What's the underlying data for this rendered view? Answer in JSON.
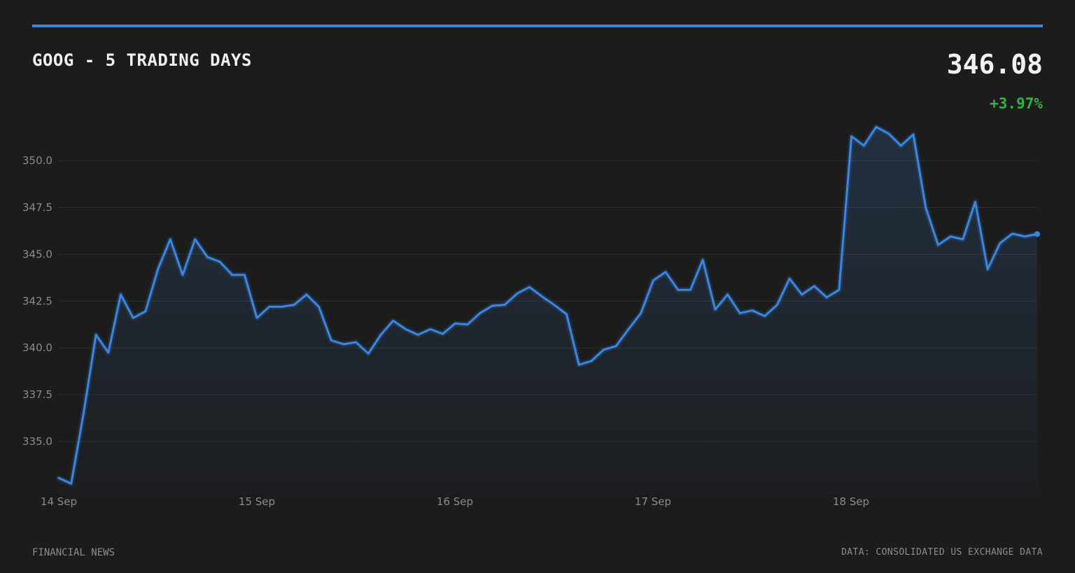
{
  "header": {
    "title": "GOOG - 5 TRADING DAYS",
    "price": "346.08",
    "change": "+3.97%"
  },
  "footer": {
    "source_left": "FINANCIAL NEWS",
    "source_right": "DATA: CONSOLIDATED US EXCHANGE DATA"
  },
  "colors": {
    "background": "#1c1c1c",
    "accent": "#3a86e0",
    "positive": "#2fb344",
    "gridline": "#2e2e2e",
    "tick_text": "#8c8c8c"
  },
  "chart_data": {
    "type": "area",
    "title": "GOOG - 5 TRADING DAYS",
    "xlabel": "",
    "ylabel": "",
    "ylim": [
      332.2,
      352.6
    ],
    "yticks": [
      335.0,
      337.5,
      340.0,
      342.5,
      345.0,
      347.5,
      350.0
    ],
    "ytick_labels": [
      "335.0",
      "337.5",
      "340.0",
      "342.5",
      "345.0",
      "347.5",
      "350.0"
    ],
    "xticks": [
      0,
      1,
      2,
      3,
      4
    ],
    "xtick_labels": [
      "14 Sep",
      "15 Sep",
      "16 Sep",
      "17 Sep",
      "18 Sep"
    ],
    "grid": true,
    "legend": "none",
    "series": [
      {
        "values": [
          333.05,
          332.75,
          336.5,
          340.7,
          339.75,
          342.85,
          341.6,
          341.95,
          344.2,
          345.8,
          343.9,
          345.8,
          344.85,
          344.6,
          343.9,
          343.9,
          341.6,
          342.2,
          342.2,
          342.3,
          342.85,
          342.2,
          340.4,
          340.2,
          340.3,
          339.7,
          340.7,
          341.45,
          341.0,
          340.7,
          341.0,
          340.75,
          341.3,
          341.25,
          341.85,
          342.25,
          342.3,
          342.9,
          343.25,
          342.75,
          342.3,
          341.8,
          339.1,
          339.3,
          339.9,
          340.1,
          341.0,
          341.85,
          343.6,
          344.05,
          343.1,
          343.1,
          344.7,
          342.05,
          342.85,
          341.85,
          342.0,
          341.7,
          342.3,
          343.7,
          342.85,
          343.3,
          342.7,
          343.1,
          351.3,
          350.8,
          351.8,
          351.45,
          350.8,
          351.4,
          347.5,
          345.5,
          345.95,
          345.8,
          347.8,
          344.2,
          345.6,
          346.1,
          345.95,
          346.08
        ]
      }
    ]
  }
}
